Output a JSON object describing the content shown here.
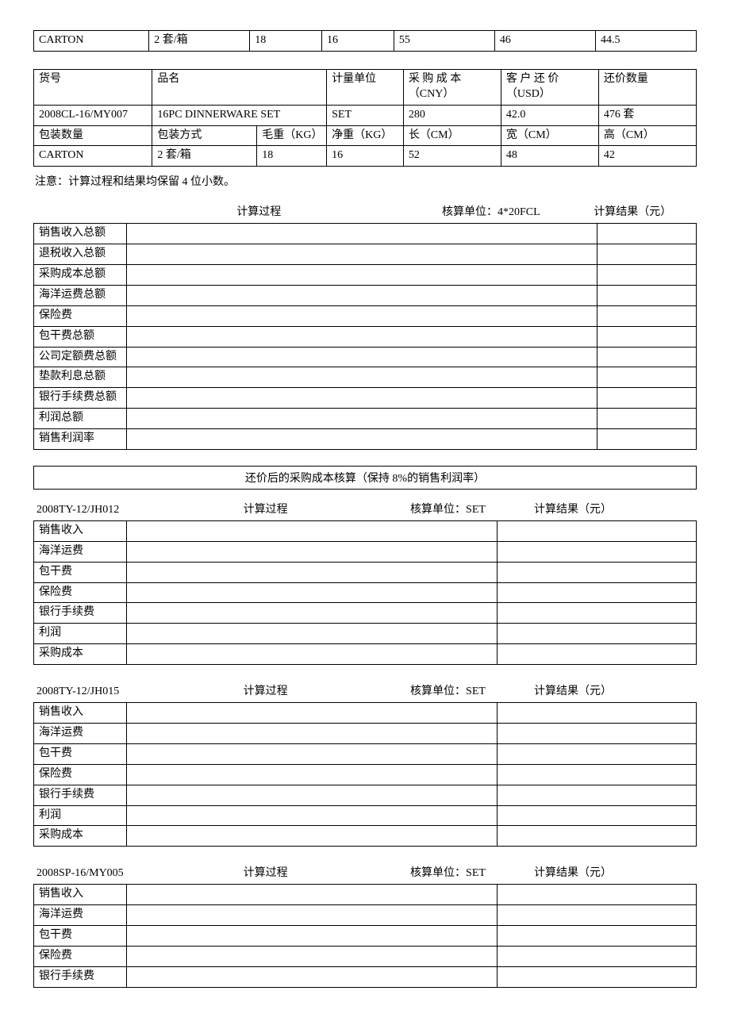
{
  "table1": {
    "row": [
      "CARTON",
      "2 套/箱",
      "18",
      "16",
      "55",
      "46",
      "44.5"
    ]
  },
  "table2": {
    "head1": [
      "货号",
      "品名",
      "计量单位",
      "采 购 成 本（CNY）",
      "客 户 还 价（USD）",
      "还价数量"
    ],
    "row1": [
      "2008CL-16/MY007",
      "16PC DINNERWARE SET",
      "SET",
      "280",
      "42.0",
      "476 套"
    ],
    "head2": [
      "包装数量",
      "包装方式",
      "毛重（KG）",
      "净重（KG）",
      "长（CM）",
      "宽（CM）",
      "高（CM）"
    ],
    "row2": [
      "CARTON",
      "2 套/箱",
      "18",
      "16",
      "52",
      "48",
      "42"
    ]
  },
  "note": "注意：计算过程和结果均保留 4 位小数。",
  "calcHeader": {
    "c1": "计算过程",
    "c2": "核算单位：4*20FCL",
    "c3": "计算结果（元）"
  },
  "calcRows": [
    "销售收入总额",
    "退税收入总额",
    "采购成本总额",
    "海洋运费总额",
    "保险费",
    "包干费总额",
    "公司定额费总额",
    "垫款利息总额",
    "银行手续费总额",
    "利润总额",
    "销售利润率"
  ],
  "sectionTitle": "还价后的采购成本核算（保持 8%的销售利润率）",
  "smHeader": {
    "c1": "计算过程",
    "c2": "核算单位：SET",
    "c3": "计算结果（元）"
  },
  "smRows": [
    "销售收入",
    "海洋运费",
    "包干费",
    "保险费",
    "银行手续费",
    "利润",
    "采购成本"
  ],
  "smRowsPartial": [
    "销售收入",
    "海洋运费",
    "包干费",
    "保险费",
    "银行手续费"
  ],
  "codes": {
    "a": "2008TY-12/JH012",
    "b": "2008TY-12/JH015",
    "c": "2008SP-16/MY005"
  }
}
